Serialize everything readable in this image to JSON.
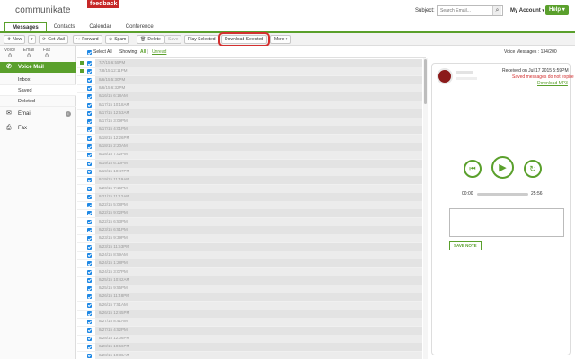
{
  "header": {
    "logo": "communikate",
    "feedback": "feedback",
    "subject_label": "Subject:",
    "search_placeholder": "Search Email...",
    "account": "My Account",
    "help": "Help"
  },
  "tabs": [
    {
      "label": "Messages"
    },
    {
      "label": "Contacts"
    },
    {
      "label": "Calendar"
    },
    {
      "label": "Conference"
    }
  ],
  "toolbar": {
    "new": "New",
    "get_mail": "Get Mail",
    "forward": "Forward",
    "spam": "Spam",
    "delete": "Delete",
    "save": "Save",
    "play_selected": "Play Selected",
    "download_selected": "Download Selected",
    "more": "More"
  },
  "sidebar": {
    "counts": [
      {
        "label": "Voice",
        "value": "0"
      },
      {
        "label": "Email",
        "value": "0"
      },
      {
        "label": "Fax",
        "value": "0"
      }
    ],
    "voice_mail": "Voice Mail",
    "inbox": "Inbox",
    "saved": "Saved",
    "deleted": "Deleted",
    "email": "Email",
    "fax": "Fax"
  },
  "list_header": {
    "select_all": "Select All",
    "showing": "Showing:",
    "all": "All",
    "sep": "|",
    "unread": "Unread",
    "vm_count": "Voice Messages : 134/200"
  },
  "rows": [
    {
      "t": "7/7/15 6:55PM"
    },
    {
      "t": "7/8/15 12:11PM"
    },
    {
      "t": "8/6/15 5:30PM"
    },
    {
      "t": "8/6/15 6:32PM"
    },
    {
      "t": "8/16/15 6:18AM"
    },
    {
      "t": "8/17/15 10:18AM"
    },
    {
      "t": "8/17/15 12:53AM"
    },
    {
      "t": "8/17/15 3:09PM"
    },
    {
      "t": "8/17/15 4:01PM"
    },
    {
      "t": "8/18/15 12:26PM"
    },
    {
      "t": "8/18/15 2:20AM"
    },
    {
      "t": "8/18/15 7:02PM"
    },
    {
      "t": "8/19/15 6:10PM"
    },
    {
      "t": "8/19/15 10:47PM"
    },
    {
      "t": "8/19/15 11:49AM"
    },
    {
      "t": "8/20/15 7:16PM"
    },
    {
      "t": "8/21/15 11:12AM"
    },
    {
      "t": "8/22/15 5:08PM"
    },
    {
      "t": "8/22/15 9:02PM"
    },
    {
      "t": "8/22/15 6:53PM"
    },
    {
      "t": "8/23/15 6:51PM"
    },
    {
      "t": "8/23/15 9:39PM"
    },
    {
      "t": "8/23/15 11:53PM"
    },
    {
      "t": "8/24/15 8:59AM"
    },
    {
      "t": "8/24/15 1:28PM"
    },
    {
      "t": "8/24/15 3:07PM"
    },
    {
      "t": "8/25/15 10:42AM"
    },
    {
      "t": "8/25/15 9:55PM"
    },
    {
      "t": "8/26/15 11:48PM"
    },
    {
      "t": "8/26/15 7:51AM"
    },
    {
      "t": "8/26/15 12:45PM"
    },
    {
      "t": "8/27/15 8:41AM"
    },
    {
      "t": "8/27/15 4:52PM"
    },
    {
      "t": "8/28/15 12:06PM"
    },
    {
      "t": "8/28/15 10:56PM"
    },
    {
      "t": "8/28/15 10:36AM"
    }
  ],
  "player": {
    "received": "Received on Jul 17 2015 5:59PM",
    "saved_msg": "Saved messages do not expire",
    "download_mp3": "Download MP3",
    "time_start": "00:00",
    "time_end": "25:56",
    "save_note": "SAVE NOTE"
  },
  "icons": {
    "prev": "⏮",
    "play": "▶",
    "replay": "↻",
    "search": "⌕",
    "phone": "✆",
    "email": "✉",
    "fax": "⎙"
  },
  "colors": {
    "brand_green": "#5aa02c",
    "checkbox_blue": "#1e88e5",
    "alert_red": "#d32f2f",
    "highlight_red": "#d32f2f",
    "feedback_red": "#c62828"
  }
}
